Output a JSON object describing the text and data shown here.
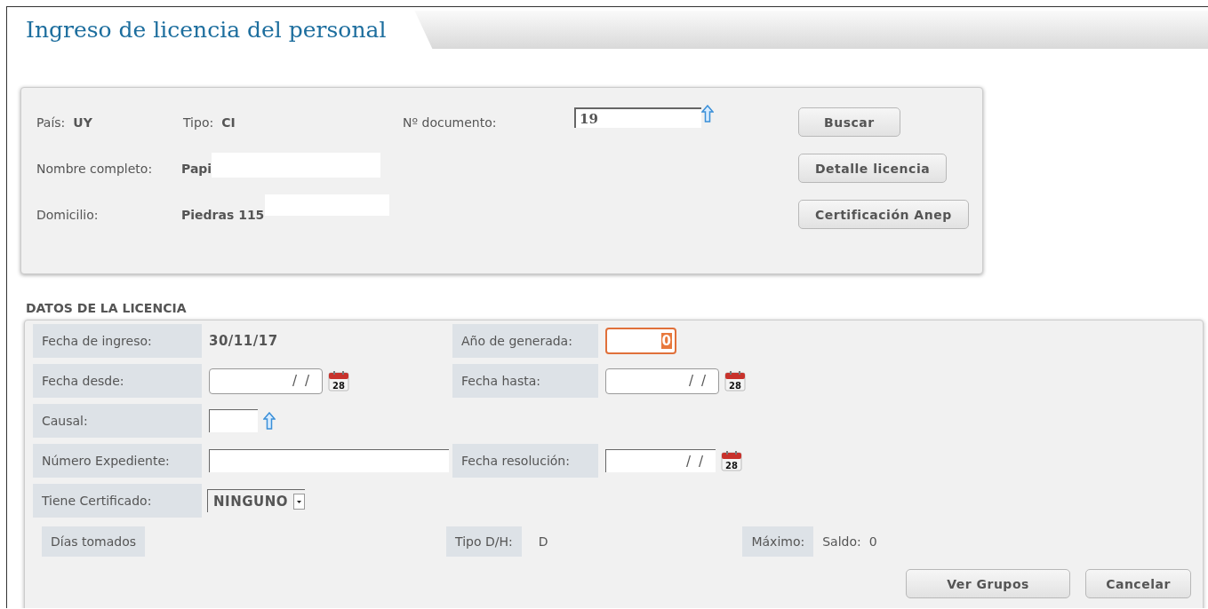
{
  "window": {
    "title": "Ingreso de licencia del personal"
  },
  "person": {
    "pais": {
      "label": "País:",
      "value": "UY"
    },
    "tipo": {
      "label": "Tipo:",
      "value": "CI"
    },
    "document": {
      "label": "Nº documento:",
      "value": "19"
    },
    "name": {
      "label": "Nombre completo:",
      "value": "Papi"
    },
    "address": {
      "label": "Domicilio:",
      "value": "Piedras 115"
    },
    "buttons": [
      "Buscar",
      "Detalle licencia",
      "Certificación Anep"
    ]
  },
  "license": {
    "heading": "DATOS DE LA LICENCIA",
    "rows": [
      {
        "cells": [
          {
            "label": "Fecha de ingreso:",
            "kind": "text",
            "value": "30/11/17"
          },
          {
            "label": "Año de generada:",
            "kind": "number",
            "value": "0",
            "focused": true
          }
        ]
      },
      {
        "cells": [
          {
            "label": "Fecha desde:",
            "kind": "date",
            "value": "/ /",
            "calendar_day": "28"
          },
          {
            "label": "Fecha hasta:",
            "kind": "date",
            "value": "/ /",
            "calendar_day": "28"
          }
        ]
      },
      {
        "cells": [
          {
            "label": "Causal:",
            "kind": "lookup"
          }
        ]
      },
      {
        "cells": [
          {
            "label": "Número Expediente:",
            "kind": "input"
          },
          {
            "label": "Fecha resolución:",
            "kind": "date_flat",
            "value": "/ /",
            "calendar_day": "28"
          }
        ]
      },
      {
        "cells": [
          {
            "label": "Tiene Certificado:",
            "kind": "select",
            "value": "NINGUNO"
          }
        ]
      }
    ],
    "summary": {
      "days": {
        "label": "Días tomados"
      },
      "type": {
        "label": "Tipo D/H:",
        "value": "D"
      },
      "max": {
        "label": "Máximo:"
      },
      "balance": {
        "label": "Saldo:",
        "value": "0"
      }
    },
    "buttons": [
      "Ver Grupos",
      "Cancelar"
    ]
  }
}
